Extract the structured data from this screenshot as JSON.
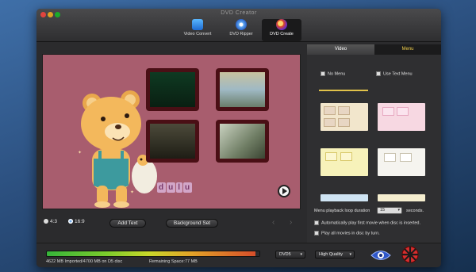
{
  "window": {
    "title": "DVD Creator"
  },
  "toolbar": {
    "items": [
      {
        "label": "Video Convert",
        "icon": "video-convert-icon"
      },
      {
        "label": "DVD Ripper",
        "icon": "dvd-ripper-icon"
      },
      {
        "label": "DVD Create",
        "icon": "dvd-create-icon",
        "active": true
      }
    ]
  },
  "preview": {
    "background_color": "#a85d6e",
    "overlay_text": [
      "d",
      "u",
      "l",
      "u"
    ],
    "aspect": {
      "option1": "4:3",
      "option2": "16:9",
      "selected": "16:9"
    },
    "add_text_label": "Add Text",
    "background_set_label": "Background Set"
  },
  "panel": {
    "tabs": {
      "video": "Video",
      "menu": "Menu",
      "active": "Menu"
    },
    "no_menu_label": "No Menu",
    "use_text_menu_label": "Use Text Menu",
    "loop_label": "Menu playback loop duration",
    "loop_value": "15",
    "loop_unit": "seconds.",
    "autoplay_label": "Automatically play first movie when disc is inserted.",
    "playall_label": "Play all movies in disc by turn."
  },
  "status": {
    "imported_text": "4622 MB Imported/4700 MB on D5 disc",
    "remaining_text": "Remaining Space:77 MB",
    "fill_fraction": 0.983,
    "disc_type": "DVD5",
    "quality": "High Quality"
  },
  "colors": {
    "accent": "#f2d04c",
    "meter_green": "#36b43a",
    "meter_red": "#d6492a"
  }
}
